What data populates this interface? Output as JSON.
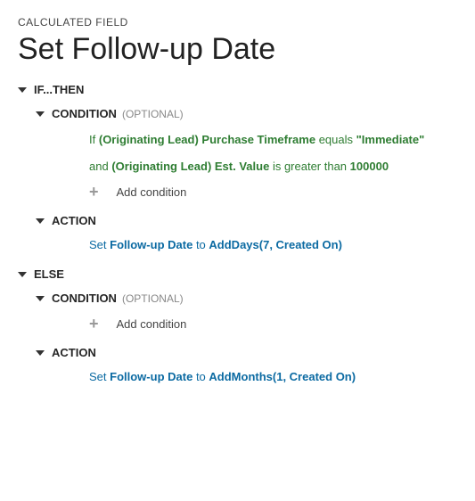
{
  "header": {
    "breadcrumb": "CALCULATED FIELD",
    "title": "Set Follow-up Date"
  },
  "labels": {
    "ifthen": "IF...THEN",
    "else": "ELSE",
    "condition": "CONDITION",
    "optional": "(OPTIONAL)",
    "action": "ACTION",
    "add_condition": "Add condition"
  },
  "ifBlock": {
    "cond1": {
      "prefix": "If",
      "field": "(Originating Lead) Purchase Timeframe",
      "op": "equals",
      "value": "\"Immediate\""
    },
    "cond2": {
      "prefix": "and",
      "field": "(Originating Lead) Est. Value",
      "op": "is greater than",
      "value": "100000"
    },
    "action": {
      "verb": "Set",
      "field": "Follow-up Date",
      "to": "to",
      "func": "AddDays(7, Created On)"
    }
  },
  "elseBlock": {
    "action": {
      "verb": "Set",
      "field": "Follow-up Date",
      "to": "to",
      "func": "AddMonths(1, Created On)"
    }
  }
}
